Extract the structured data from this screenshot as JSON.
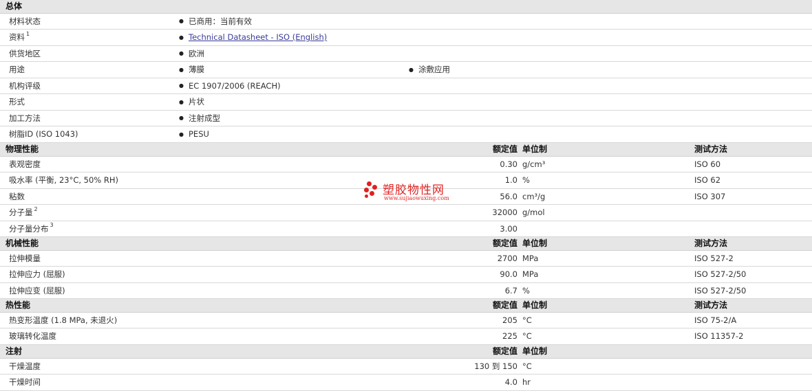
{
  "general": {
    "title": "总体",
    "material_status": {
      "label": "材料状态",
      "value": "已商用：当前有效"
    },
    "resources": {
      "label": "资料",
      "sup": "1",
      "value": "Technical Datasheet - ISO (English)"
    },
    "availability": {
      "label": "供货地区",
      "value": "欧洲"
    },
    "uses": {
      "label": "用途",
      "value1": "薄膜",
      "value2": "涂敷应用"
    },
    "agency": {
      "label": "机构评级",
      "value": "EC 1907/2006 (REACH)"
    },
    "forms": {
      "label": "形式",
      "value": "片状"
    },
    "processing": {
      "label": "加工方法",
      "value": "注射成型"
    },
    "resin_id": {
      "label": "树脂ID (ISO 1043)",
      "value": "PESU"
    }
  },
  "columns": {
    "nominal": "额定值",
    "unit": "单位制",
    "test": "测试方法"
  },
  "physical": {
    "title": "物理性能",
    "rows": [
      {
        "label": "表观密度",
        "sup": "",
        "value": "0.30",
        "unit": "g/cm³",
        "test": "ISO 60"
      },
      {
        "label": "吸水率 (平衡, 23°C, 50% RH)",
        "sup": "",
        "value": "1.0",
        "unit": "%",
        "test": "ISO 62"
      },
      {
        "label": "粘数",
        "sup": "",
        "value": "56.0",
        "unit": "cm³/g",
        "test": "ISO 307"
      },
      {
        "label": "分子量",
        "sup": "2",
        "value": "32000",
        "unit": "g/mol",
        "test": ""
      },
      {
        "label": "分子量分布",
        "sup": "3",
        "value": "3.00",
        "unit": "",
        "test": ""
      }
    ]
  },
  "mechanical": {
    "title": "机械性能",
    "rows": [
      {
        "label": "拉伸模量",
        "value": "2700",
        "unit": "MPa",
        "test": "ISO 527-2"
      },
      {
        "label": "拉伸应力 (屈服)",
        "value": "90.0",
        "unit": "MPa",
        "test": "ISO 527-2/50"
      },
      {
        "label": "拉伸应变 (屈服)",
        "value": "6.7",
        "unit": "%",
        "test": "ISO 527-2/50"
      }
    ]
  },
  "thermal": {
    "title": "热性能",
    "rows": [
      {
        "label": "热变形温度 (1.8 MPa, 未退火)",
        "value": "205",
        "unit": "°C",
        "test": "ISO 75-2/A"
      },
      {
        "label": "玻璃转化温度",
        "value": "225",
        "unit": "°C",
        "test": "ISO 11357-2"
      }
    ]
  },
  "injection": {
    "title": "注射",
    "rows": [
      {
        "label": "干燥温度",
        "value": "130 到 150",
        "unit": "°C",
        "test": ""
      },
      {
        "label": "干燥时间",
        "value": "4.0",
        "unit": "hr",
        "test": ""
      }
    ]
  },
  "watermark": {
    "brand": "塑胶物性网",
    "site": "www.sujiaowuxing.com",
    "color": "#e02424"
  }
}
